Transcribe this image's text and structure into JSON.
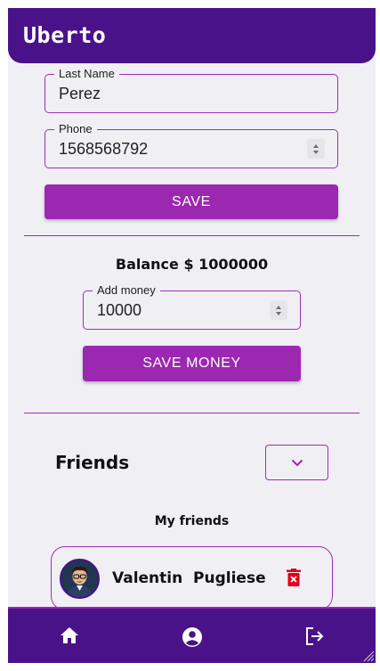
{
  "app": {
    "title": "Uberto"
  },
  "profile": {
    "last_name": {
      "label": "Last Name",
      "value": "Perez"
    },
    "phone": {
      "label": "Phone",
      "value": "1568568792"
    },
    "save_label": "SAVE"
  },
  "balance": {
    "text": "Balance $ 1000000",
    "add_money": {
      "label": "Add money",
      "value": "10000"
    },
    "save_money_label": "SAVE MONEY"
  },
  "friends": {
    "title": "Friends",
    "section_label": "My friends",
    "items": [
      {
        "name": "Valentin  Pugliese"
      }
    ]
  },
  "nav": {
    "icons": [
      "home-icon",
      "account-circle-icon",
      "logout-icon"
    ]
  },
  "colors": {
    "primary": "#4a1289",
    "accent": "#9c27b0",
    "danger": "#e0001a",
    "background": "#f0eff4"
  }
}
